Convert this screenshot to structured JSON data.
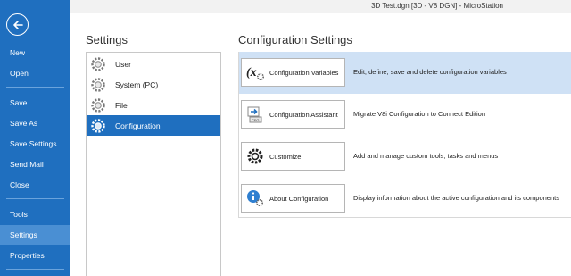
{
  "window": {
    "title": "3D Test.dgn [3D - V8 DGN] - MicroStation"
  },
  "nav": {
    "back_label": "Back",
    "items": [
      {
        "label": "New"
      },
      {
        "label": "Open"
      },
      {
        "label": "Save"
      },
      {
        "label": "Save As"
      },
      {
        "label": "Save Settings"
      },
      {
        "label": "Send Mail"
      },
      {
        "label": "Close"
      },
      {
        "label": "Tools"
      },
      {
        "label": "Settings"
      },
      {
        "label": "Properties"
      }
    ],
    "selected": "Settings"
  },
  "settings": {
    "title": "Settings",
    "items": [
      {
        "label": "User",
        "icon": "gear-icon"
      },
      {
        "label": "System (PC)",
        "icon": "gear-icon"
      },
      {
        "label": "File",
        "icon": "gear-icon"
      },
      {
        "label": "Configuration",
        "icon": "gear-icon"
      }
    ],
    "selected": "Configuration"
  },
  "configuration": {
    "title": "Configuration Settings",
    "rows": [
      {
        "button": "Configuration Variables",
        "description": "Edit, define, save and delete configuration variables",
        "icon": "variable-x-icon"
      },
      {
        "button": "Configuration Assistant",
        "description": "Migrate V8i Configuration to Connect Edition",
        "icon": "migrate-assistant-icon"
      },
      {
        "button": "Customize",
        "description": "Add and manage custom tools, tasks and menus",
        "icon": "customize-gear-icon"
      },
      {
        "button": "About Configuration",
        "description": "Display information about the active configuration and its components",
        "icon": "info-icon"
      }
    ],
    "selected_row": "Configuration Variables"
  },
  "colors": {
    "nav_background": "#1f6fbf",
    "nav_selected": "#4a8fd3",
    "list_selected": "#1f6fbf",
    "row_selected": "#cfe1f5"
  }
}
